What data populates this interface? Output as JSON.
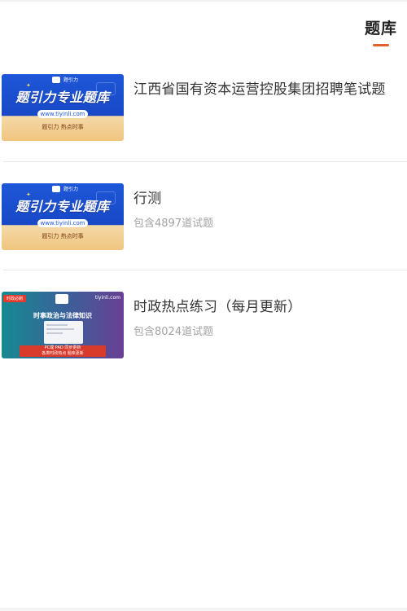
{
  "header": {
    "tab_label": "题库",
    "accent_color": "#e0612b"
  },
  "items": [
    {
      "title": "江西省国有资本运营控股集团招聘笔试题",
      "count_text": "",
      "thumbnail": {
        "title": "题引力专业题库",
        "url": "www.tiyinli.com",
        "subtitle": "题引力 热点时事",
        "brand": "题引力"
      }
    },
    {
      "title": "行测",
      "count_text": "包含4897道试题",
      "thumbnail": {
        "title": "题引力专业题库",
        "url": "www.tiyinli.com",
        "subtitle": "题引力 热点时事",
        "brand": "题引力"
      }
    },
    {
      "title": "时政热点练习（每月更新）",
      "count_text": "包含8024道试题",
      "thumbnail": {
        "badge": "时政必刷",
        "site": "tiyinli.com",
        "headline": "时事政治与法律知识",
        "foot_line1": "PC端 PAD 同步更新",
        "foot_line2": "各类时政热点 题库更新"
      }
    }
  ]
}
